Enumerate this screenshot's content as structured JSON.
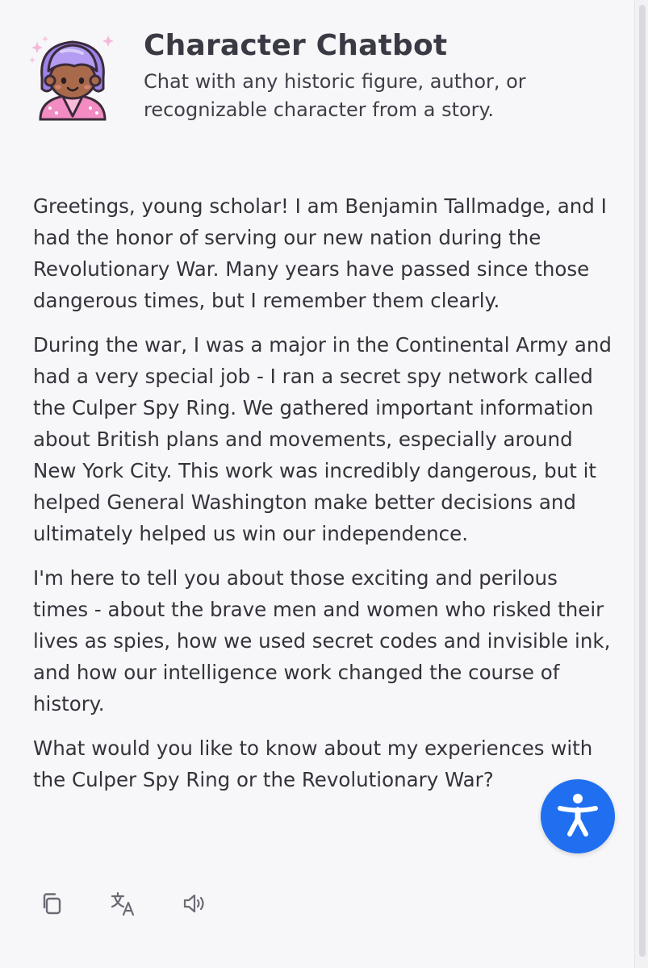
{
  "header": {
    "title": "Character Chatbot",
    "subtitle": "Chat with any historic figure, author, or recognizable character from a story.",
    "avatar_icon": "character-avatar-icon"
  },
  "message": {
    "paragraphs": [
      "Greetings, young scholar! I am Benjamin Tallmadge, and I had the honor of serving our new nation during the Revolutionary War. Many years have passed since those dangerous times, but I remember them clearly.",
      "During the war, I was a major in the Continental Army and had a very special job - I ran a secret spy network called the Culper Spy Ring. We gathered important information about British plans and movements, especially around New York City. This work was incredibly dangerous, but it helped General Washington make better decisions and ultimately helped us win our independence.",
      "I'm here to tell you about those exciting and perilous times - about the brave men and women who risked their lives as spies, how we used secret codes and invisible ink, and how our intelligence work changed the course of history.",
      "What would you like to know about my experiences with the Culper Spy Ring or the Revolutionary War?"
    ]
  },
  "actions": [
    {
      "icon": "copy-icon"
    },
    {
      "icon": "translate-icon"
    },
    {
      "icon": "speaker-icon"
    }
  ],
  "accessibility": {
    "icon": "accessibility-icon",
    "color": "#1f6ff0"
  }
}
